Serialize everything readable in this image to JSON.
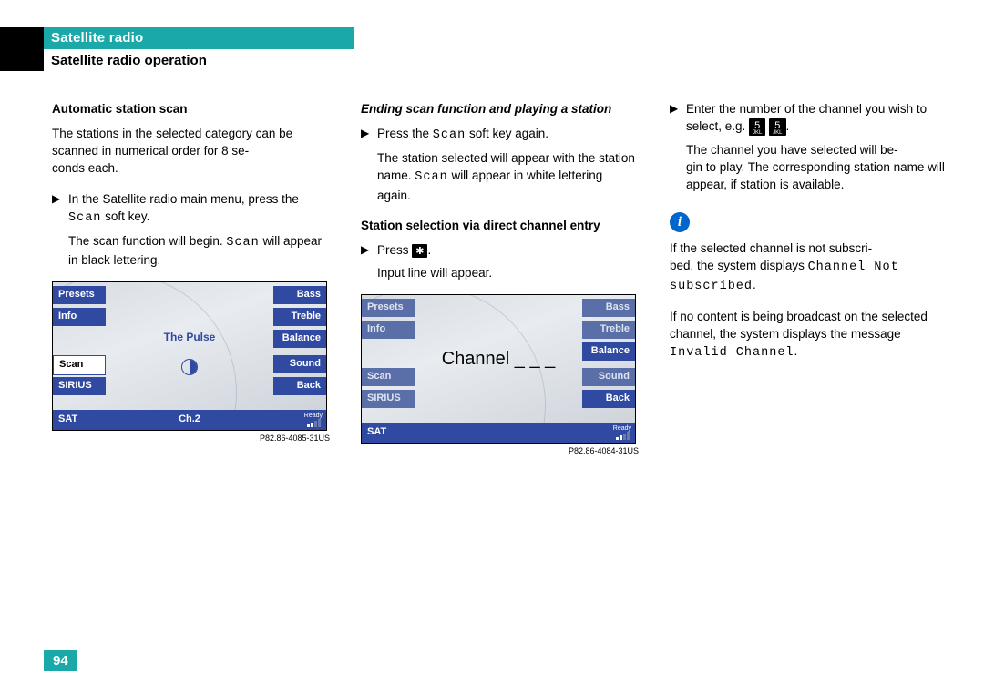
{
  "header": {
    "chapter": "Satellite radio",
    "section": "Satellite radio operation"
  },
  "col1": {
    "h1": "Automatic station scan",
    "p1a": "The stations in the selected category can be scanned in numerical order for 8 se",
    "p1b": "conds each.",
    "b1a": "In the Satellite radio main menu, press the ",
    "b1_scan": "Scan",
    "b1b": " soft key.",
    "p2a": "The scan function will begin. ",
    "p2_scan": "Scan",
    "p2b": " will appear in black lettering."
  },
  "radio1": {
    "left": [
      "Presets",
      "Info",
      "",
      "Scan",
      "SIRIUS"
    ],
    "right": [
      "Bass",
      "Treble",
      "Balance",
      "Sound",
      "Back"
    ],
    "center": "The Pulse",
    "bottom_left": "SAT",
    "bottom_center": "Ch.2",
    "ready": "Ready",
    "caption": "P82.86-4085-31US"
  },
  "col2": {
    "h1": "Ending scan function and playing a station",
    "b1a": "Press the ",
    "b1_scan": "Scan",
    "b1b": " soft key again.",
    "p1a": "The station selected will appear with the station name. ",
    "p1_scan": "Scan",
    "p1b": " will appear in white lettering again.",
    "h2": "Station selection via direct channel entry",
    "b2a": "Press ",
    "b2_key": "✱",
    "b2b": ".",
    "p2": "Input line will appear."
  },
  "radio2": {
    "left": [
      "Presets",
      "Info",
      "",
      "Scan",
      "SIRIUS"
    ],
    "right": [
      "Bass",
      "Treble",
      "Balance",
      "Sound",
      "Back"
    ],
    "center": "Channel _ _ _",
    "bottom_left": "SAT",
    "bottom_center": "",
    "ready": "Ready",
    "caption": "P82.86-4084-31US"
  },
  "col3": {
    "b1a": "Enter the number of the channel you wish to select, e.g. ",
    "key1_top": "5",
    "key1_sub": "JKL",
    "key2_top": "5",
    "key2_sub": "JKL",
    "b1b": ".",
    "p1a": "The channel you have selected will be",
    "p1b": "gin to play. The corresponding station name will appear, if station is available.",
    "info1a": "If the selected channel is not subscri",
    "info1b": "bed, the system displays ",
    "info1_mono": "Channel Not subscribed",
    "info1c": ".",
    "info2a": "If no content is being broadcast on the selected channel, the system displays the message ",
    "info2_mono": "Invalid Channel",
    "info2b": "."
  },
  "page_number": "94"
}
